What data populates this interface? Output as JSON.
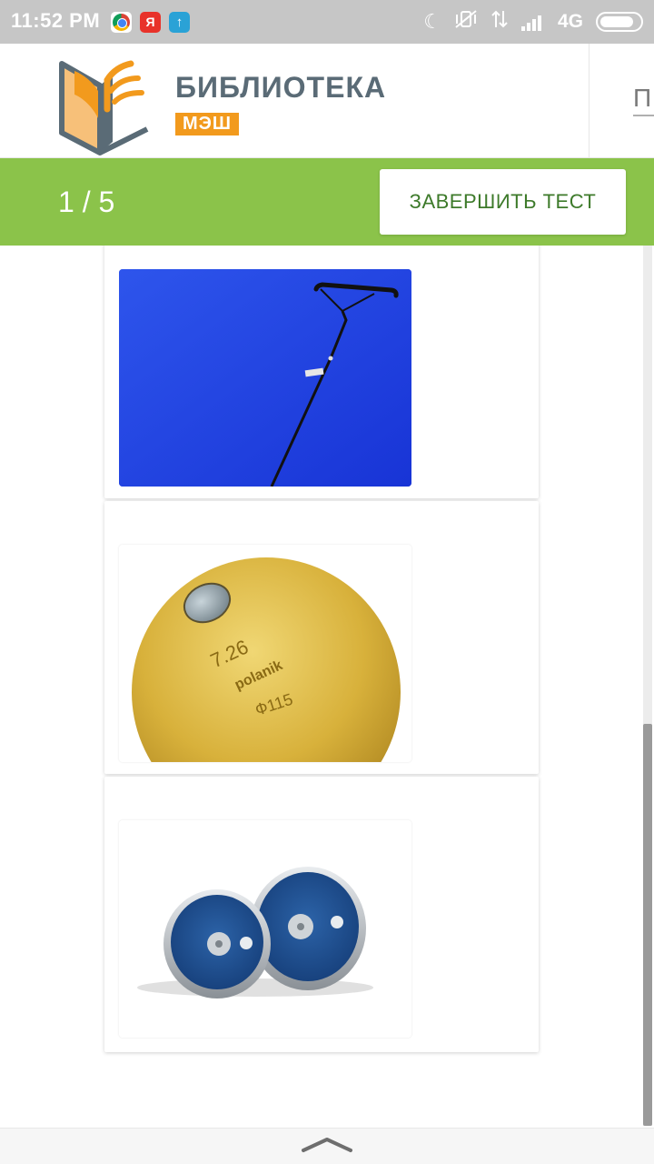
{
  "status_bar": {
    "time": "11:52 PM",
    "network": "4G",
    "app_icons": [
      "chrome-icon",
      "yandex-icon",
      "upload-icon"
    ],
    "system_icons": [
      "moon-icon",
      "vibrate-off-icon",
      "data-arrows-icon",
      "signal-icon",
      "battery-icon"
    ]
  },
  "header": {
    "logo_title": "БИБЛИОТЕКА",
    "logo_badge": "МЭШ",
    "cut_text": "П"
  },
  "test_bar": {
    "counter": "1 / 5",
    "finish_button": "ЗАВЕРШИТЬ ТЕСТ"
  },
  "answers": [
    {
      "image": "hammer-throw-image"
    },
    {
      "image": "shot-put-image",
      "engraving": [
        "7.26",
        "polanik",
        "Ф115"
      ]
    },
    {
      "image": "discus-image"
    }
  ],
  "colors": {
    "green_bar": "#8bc34a",
    "button_text": "#3d7a2a",
    "logo_orange": "#f29a1d",
    "logo_gray": "#5a6b76"
  }
}
